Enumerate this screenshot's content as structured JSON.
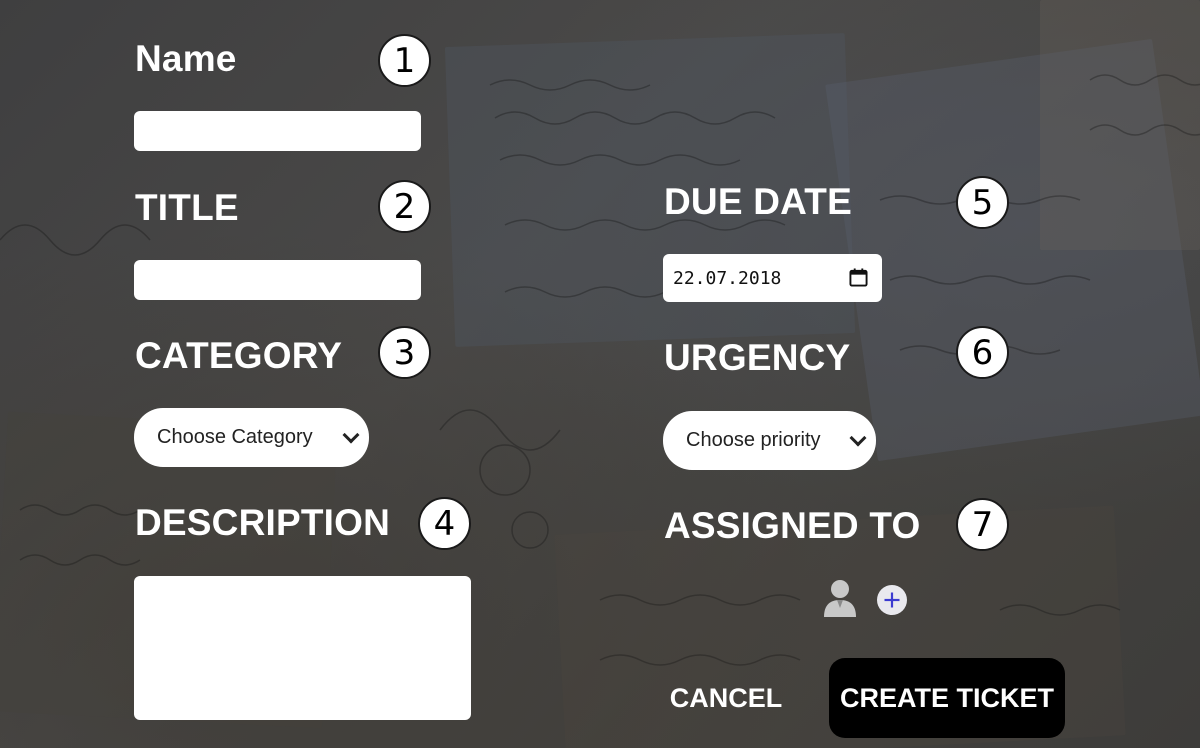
{
  "form": {
    "name": {
      "label": "Name",
      "badge": "1",
      "value": ""
    },
    "title": {
      "label": "TITLE",
      "badge": "2",
      "value": ""
    },
    "category": {
      "label": "CATEGORY",
      "badge": "3",
      "selected": "Choose Category"
    },
    "description": {
      "label": "DESCRIPTION",
      "badge": "4",
      "value": ""
    },
    "due_date": {
      "label": "DUE DATE",
      "badge": "5",
      "value": "22.07.2018",
      "icon": "calendar-icon"
    },
    "urgency": {
      "label": "URGENCY",
      "badge": "6",
      "selected": "Choose priority"
    },
    "assigned_to": {
      "label": "ASSIGNED TO",
      "badge": "7",
      "icons": [
        "user-icon",
        "add-circle-icon"
      ]
    }
  },
  "actions": {
    "cancel_label": "CANCEL",
    "create_label": "CREATE TICKET"
  },
  "colors": {
    "background": "#464545",
    "label": "#ffffff",
    "input_bg": "#ffffff",
    "create_button_bg": "#000000",
    "add_icon": "#3b3bd0"
  }
}
